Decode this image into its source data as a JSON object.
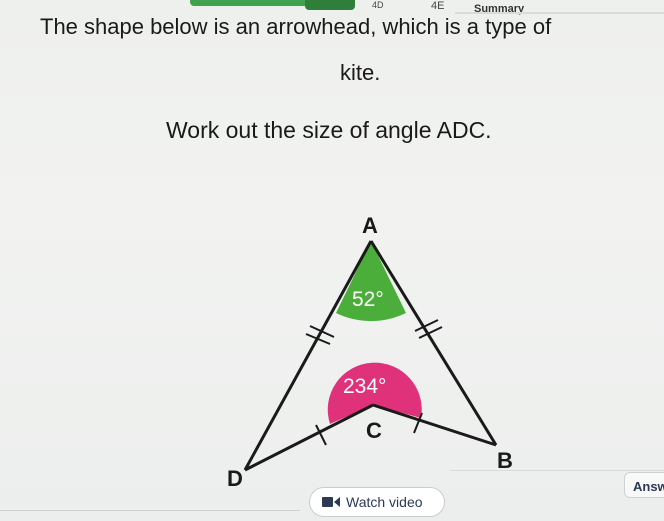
{
  "tabs": {
    "tab_4d": "4D",
    "tab_4e": "4E",
    "summary": "Summary"
  },
  "question": {
    "line1": "The shape below is an arrowhead, which is a type of",
    "line2": "kite.",
    "line3": "Work out the size of angle ADC."
  },
  "diagram": {
    "vertex_a": "A",
    "vertex_b": "B",
    "vertex_c": "C",
    "vertex_d": "D",
    "angle_a": "52°",
    "angle_c": "234°",
    "color_angle_a": "#4cae3a",
    "color_angle_c": "#e0327a"
  },
  "controls": {
    "answer_label": "Answ",
    "watch_video_label": "Watch video"
  }
}
